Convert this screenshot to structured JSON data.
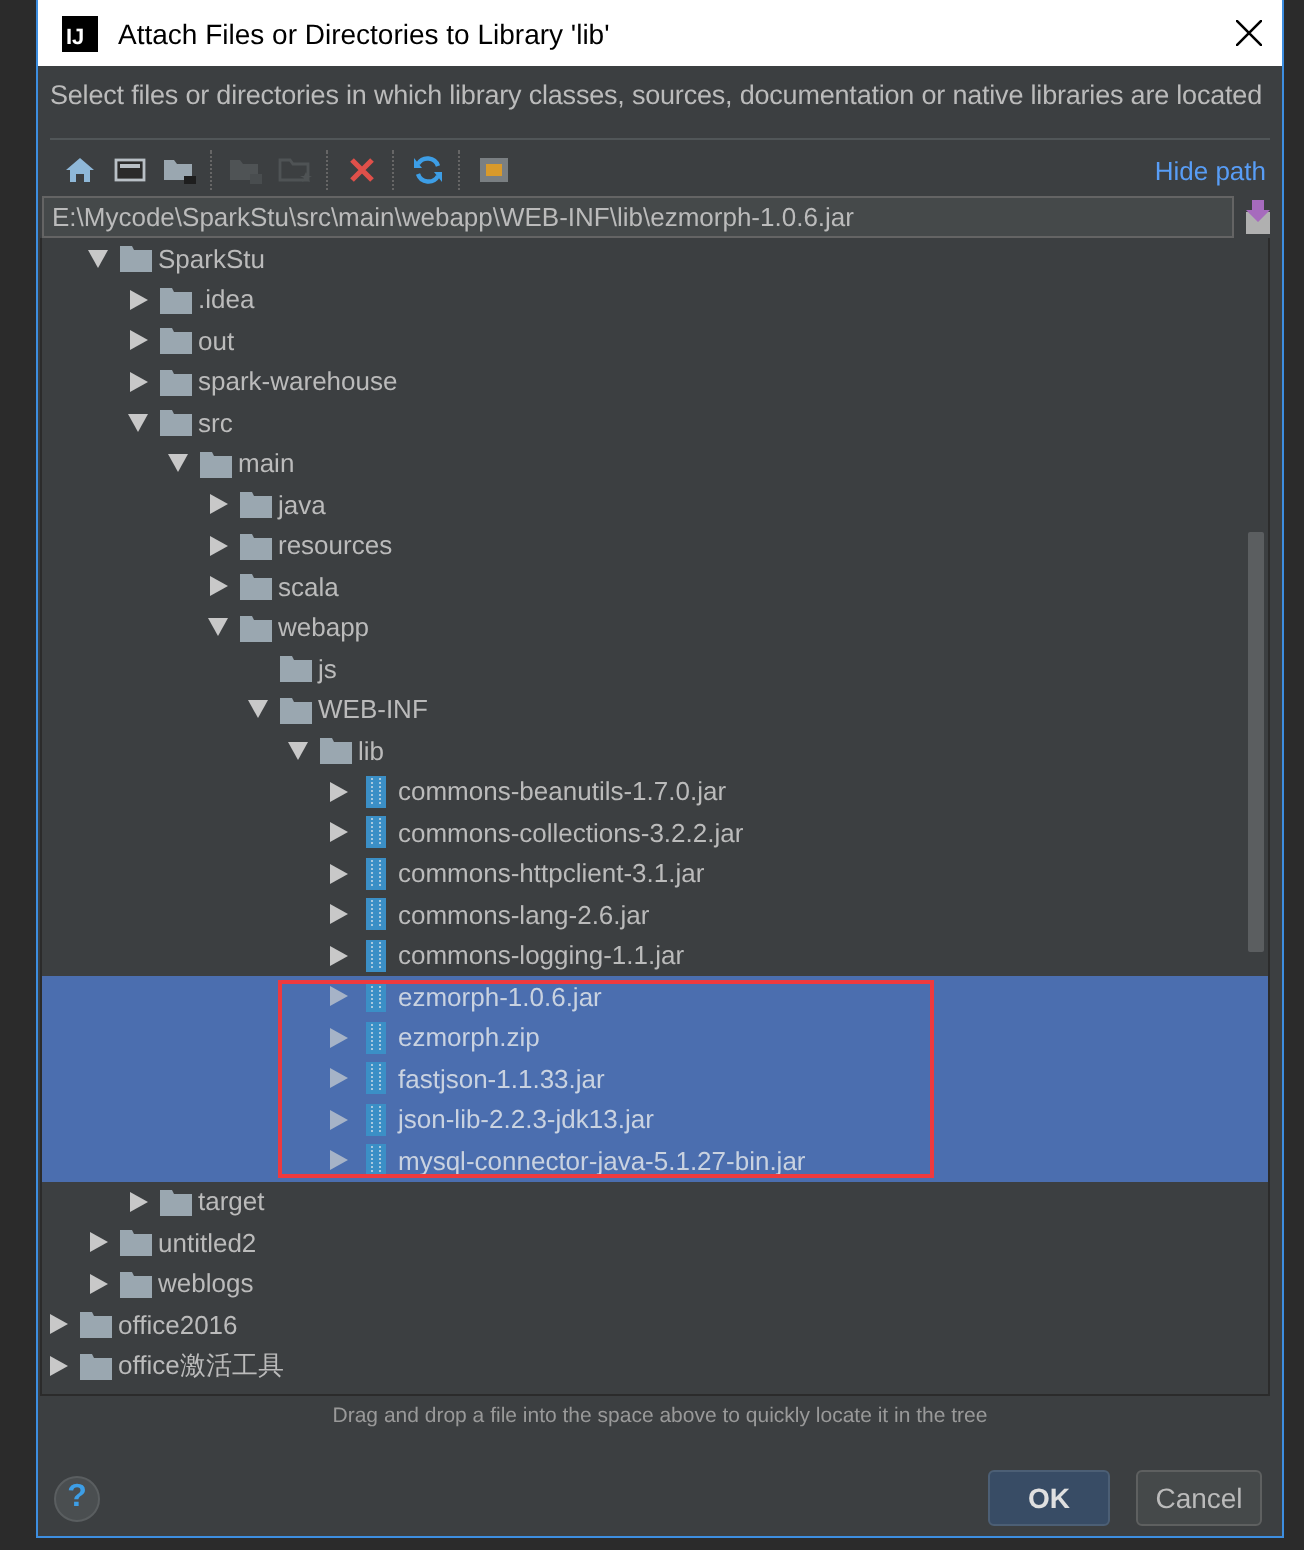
{
  "window": {
    "logo": "IJ",
    "title": "Attach Files or Directories to Library 'lib'"
  },
  "description": "Select files or directories in which library classes, sources, documentation or native libraries are located",
  "toolbar": {
    "buttons": [
      {
        "kind": "home",
        "disabled": false
      },
      {
        "kind": "desktop",
        "disabled": false
      },
      {
        "kind": "project",
        "disabled": false
      },
      {
        "kind": "module",
        "disabled": true
      },
      {
        "kind": "new-folder",
        "disabled": true
      },
      {
        "kind": "delete",
        "disabled": false
      },
      {
        "kind": "refresh",
        "disabled": false
      },
      {
        "kind": "hidden-files",
        "disabled": false
      }
    ],
    "link": "Hide path"
  },
  "path_field": {
    "value": "E:\\Mycode\\SparkStu\\src\\main\\webapp\\WEB-INF\\lib\\ezmorph-1.0.6.jar"
  },
  "tree": {
    "items": [
      {
        "children": [
          {
            "label": "SparkStu",
            "kind": "folder",
            "expanded": true,
            "selected": false,
            "children": [
              {
                "label": ".idea",
                "kind": "folder",
                "expanded": false,
                "selected": false
              },
              {
                "label": "out",
                "kind": "folder",
                "expanded": false,
                "selected": false
              },
              {
                "label": "spark-warehouse",
                "kind": "folder",
                "expanded": false,
                "selected": false
              },
              {
                "label": "src",
                "kind": "folder",
                "expanded": true,
                "selected": false,
                "children": [
                  {
                    "label": "main",
                    "kind": "folder",
                    "expanded": true,
                    "selected": false,
                    "children": [
                      {
                        "label": "java",
                        "kind": "folder",
                        "expanded": false,
                        "selected": false
                      },
                      {
                        "label": "resources",
                        "kind": "folder",
                        "expanded": false,
                        "selected": false
                      },
                      {
                        "label": "scala",
                        "kind": "folder",
                        "expanded": false,
                        "selected": false
                      },
                      {
                        "label": "webapp",
                        "kind": "folder",
                        "expanded": true,
                        "selected": false,
                        "children": [
                          {
                            "label": "js",
                            "kind": "folder",
                            "selected": false
                          },
                          {
                            "label": "WEB-INF",
                            "kind": "folder",
                            "expanded": true,
                            "selected": false,
                            "children": [
                              {
                                "label": "lib",
                                "kind": "folder",
                                "expanded": true,
                                "selected": false,
                                "children": [
                                  {
                                    "label": "commons-beanutils-1.7.0.jar",
                                    "kind": "jar",
                                    "expanded": false,
                                    "selected": false
                                  },
                                  {
                                    "label": "commons-collections-3.2.2.jar",
                                    "kind": "jar",
                                    "expanded": false,
                                    "selected": false
                                  },
                                  {
                                    "label": "commons-httpclient-3.1.jar",
                                    "kind": "jar",
                                    "expanded": false,
                                    "selected": false
                                  },
                                  {
                                    "label": "commons-lang-2.6.jar",
                                    "kind": "jar",
                                    "expanded": false,
                                    "selected": false
                                  },
                                  {
                                    "label": "commons-logging-1.1.jar",
                                    "kind": "jar",
                                    "expanded": false,
                                    "selected": false
                                  },
                                  {
                                    "label": "ezmorph-1.0.6.jar",
                                    "kind": "jar",
                                    "expanded": false,
                                    "selected": true
                                  },
                                  {
                                    "label": "ezmorph.zip",
                                    "kind": "jar",
                                    "expanded": false,
                                    "selected": true
                                  },
                                  {
                                    "label": "fastjson-1.1.33.jar",
                                    "kind": "jar",
                                    "expanded": false,
                                    "selected": true
                                  },
                                  {
                                    "label": "json-lib-2.2.3-jdk13.jar",
                                    "kind": "jar",
                                    "expanded": false,
                                    "selected": true
                                  },
                                  {
                                    "label": "mysql-connector-java-5.1.27-bin.jar",
                                    "kind": "jar",
                                    "expanded": false,
                                    "selected": true
                                  }
                                ]
                              }
                            ]
                          }
                        ]
                      }
                    ]
                  }
                ]
              },
              {
                "label": "target",
                "kind": "folder",
                "expanded": false,
                "selected": false
              }
            ]
          },
          {
            "label": "untitled2",
            "kind": "folder",
            "expanded": false,
            "selected": false
          },
          {
            "label": "weblogs",
            "kind": "folder",
            "expanded": false,
            "selected": false
          }
        ]
      },
      {
        "label": "office2016",
        "kind": "folder",
        "expanded": false,
        "selected": false
      },
      {
        "label": "office激活工具",
        "kind": "folder",
        "expanded": false,
        "selected": false
      }
    ]
  },
  "annotation": {
    "kind": "outline",
    "color": "#ee3a3f"
  },
  "hint": "Drag and drop a file into the space above to quickly locate it in the tree",
  "help": "?",
  "buttons": [
    {
      "label": "OK",
      "default": true
    },
    {
      "label": "Cancel",
      "default": false
    }
  ]
}
